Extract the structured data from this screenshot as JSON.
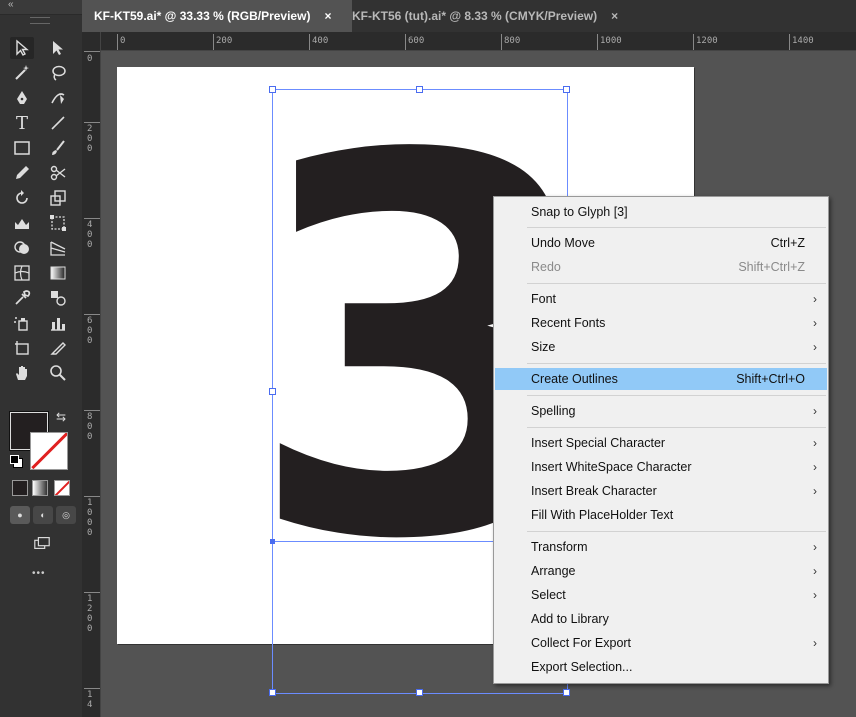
{
  "tabs": [
    {
      "label": "KF-KT59.ai* @ 33.33 % (RGB/Preview)",
      "close": "×"
    },
    {
      "label": "KF-KT56 (tut).ai* @ 8.33 % (CMYK/Preview)",
      "close": "×"
    }
  ],
  "ruler": {
    "h_labels": [
      "0",
      "200",
      "400",
      "600",
      "800",
      "1000",
      "1200",
      "1400"
    ],
    "v_labels": [
      "0",
      "200",
      "400",
      "600",
      "800",
      "1000",
      "1200",
      "14"
    ]
  },
  "canvas": {
    "glyph_text": "3",
    "glyph_color": "#231f20",
    "selection_color": "#4a6cf0"
  },
  "toolbar": {
    "collapse": "«",
    "more": "•••",
    "fill_color": "#231f20",
    "stroke": "none"
  },
  "context_menu": {
    "items": [
      {
        "label": "Snap to Glyph [3]"
      },
      {
        "label": "Undo Move",
        "shortcut": "Ctrl+Z"
      },
      {
        "label": "Redo",
        "shortcut": "Shift+Ctrl+Z",
        "disabled": true
      },
      {
        "label": "Font",
        "submenu": true
      },
      {
        "label": "Recent Fonts",
        "submenu": true
      },
      {
        "label": "Size",
        "submenu": true
      },
      {
        "label": "Create Outlines",
        "shortcut": "Shift+Ctrl+O",
        "highlighted": true
      },
      {
        "label": "Spelling",
        "submenu": true
      },
      {
        "label": "Insert Special Character",
        "submenu": true
      },
      {
        "label": "Insert WhiteSpace Character",
        "submenu": true
      },
      {
        "label": "Insert Break Character",
        "submenu": true
      },
      {
        "label": "Fill With PlaceHolder Text"
      },
      {
        "label": "Transform",
        "submenu": true
      },
      {
        "label": "Arrange",
        "submenu": true
      },
      {
        "label": "Select",
        "submenu": true
      },
      {
        "label": "Add to Library"
      },
      {
        "label": "Collect For Export",
        "submenu": true
      },
      {
        "label": "Export Selection..."
      }
    ],
    "submenu_arrow": "›"
  }
}
